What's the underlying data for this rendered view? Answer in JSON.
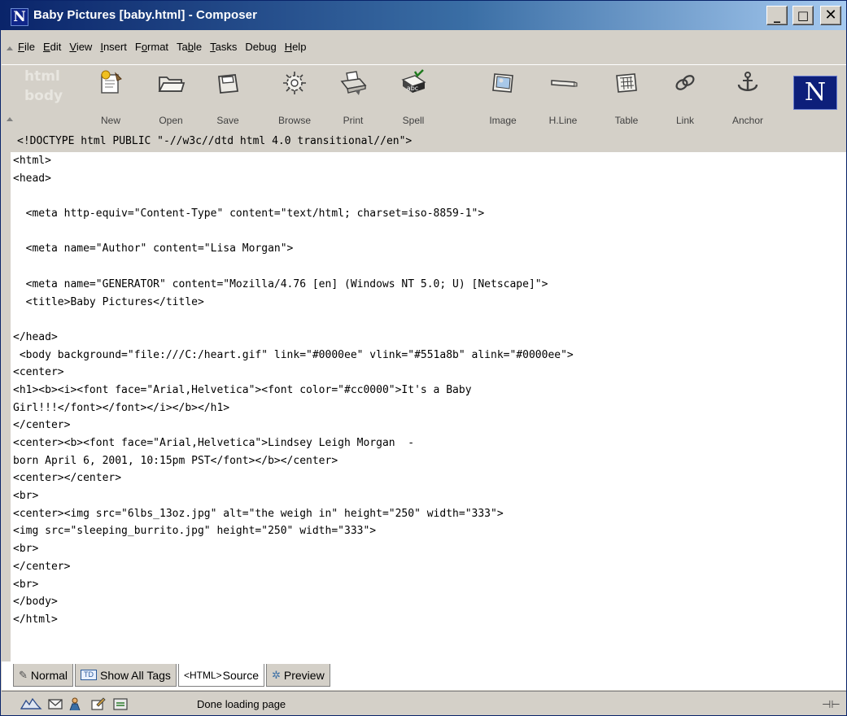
{
  "window": {
    "title": "Baby Pictures [baby.html] - Composer",
    "app_icon": "netscape-n-icon",
    "controls": {
      "minimize": "_",
      "maximize": "□",
      "close": "✕"
    }
  },
  "menu": {
    "items": [
      {
        "label": "File",
        "access": "F"
      },
      {
        "label": "Edit",
        "access": "E"
      },
      {
        "label": "View",
        "access": "V"
      },
      {
        "label": "Insert",
        "access": "I"
      },
      {
        "label": "Format",
        "access": "o"
      },
      {
        "label": "Table",
        "access": "b"
      },
      {
        "label": "Tasks",
        "access": "T"
      },
      {
        "label": "Debug",
        "access": ""
      },
      {
        "label": "Help",
        "access": "H"
      }
    ]
  },
  "toolbar": {
    "watermark": "html\nbody",
    "buttons": [
      {
        "label": "New",
        "icon": "new-page-icon"
      },
      {
        "label": "Open",
        "icon": "open-folder-icon"
      },
      {
        "label": "Save",
        "icon": "save-disk-icon"
      },
      {
        "label": "Browse",
        "icon": "browse-gear-icon"
      },
      {
        "label": "Print",
        "icon": "printer-icon"
      },
      {
        "label": "Spell",
        "icon": "spellcheck-icon"
      },
      {
        "label": "Image",
        "icon": "image-icon"
      },
      {
        "label": "H.Line",
        "icon": "horizontal-line-icon"
      },
      {
        "label": "Table",
        "icon": "table-icon"
      },
      {
        "label": "Link",
        "icon": "link-chain-icon"
      },
      {
        "label": "Anchor",
        "icon": "anchor-icon"
      }
    ],
    "brand": "N"
  },
  "editor": {
    "doctype": "<!DOCTYPE html PUBLIC \"-//w3c//dtd html 4.0 transitional//en\">",
    "lines": [
      "<html>",
      "<head>",
      "",
      "  <meta http-equiv=\"Content-Type\" content=\"text/html; charset=iso-8859-1\">",
      "",
      "  <meta name=\"Author\" content=\"Lisa Morgan\">",
      "",
      "  <meta name=\"GENERATOR\" content=\"Mozilla/4.76 [en] (Windows NT 5.0; U) [Netscape]\">",
      "  <title>Baby Pictures</title>",
      "",
      "</head>",
      " <body background=\"file:///C:/heart.gif\" link=\"#0000ee\" vlink=\"#551a8b\" alink=\"#0000ee\">",
      "<center>",
      "<h1><b><i><font face=\"Arial,Helvetica\"><font color=\"#cc0000\">It's a Baby",
      "Girl!!!</font></font></i></b></h1>",
      "</center>",
      "<center><b><font face=\"Arial,Helvetica\">Lindsey Leigh Morgan  -",
      "born April 6, 2001, 10:15pm PST</font></b></center>",
      "<center></center>",
      "<br>",
      "<center><img src=\"6lbs_13oz.jpg\" alt=\"the weigh in\" height=\"250\" width=\"333\">",
      "<img src=\"sleeping_burrito.jpg\" height=\"250\" width=\"333\">",
      "<br>",
      "</center>",
      "<br>",
      "</body>",
      "</html>"
    ]
  },
  "tabs": [
    {
      "label": "Normal",
      "icon": "pencil-icon",
      "active": false
    },
    {
      "label": "Show All Tags",
      "icon": "td-tag-icon",
      "icon_text": "TD",
      "active": false
    },
    {
      "label": "Source",
      "icon": "html-tag-icon",
      "icon_text": "<HTML>",
      "active": true
    },
    {
      "label": "Preview",
      "icon": "preview-icon",
      "active": false
    }
  ],
  "status": {
    "text": "Done loading page",
    "icons": [
      "navigator-icon",
      "mail-icon",
      "people-icon",
      "composer-icon",
      "address-book-icon"
    ],
    "online_icon": "connection-plug-icon"
  }
}
